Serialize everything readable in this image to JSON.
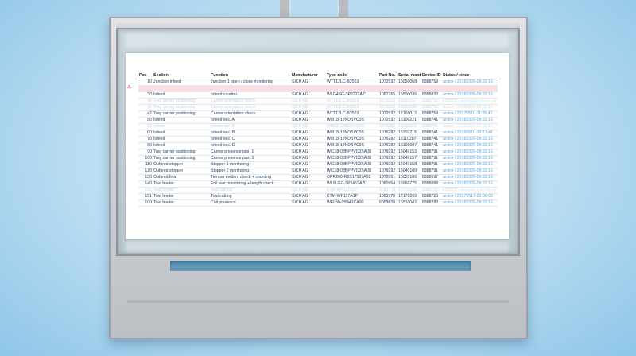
{
  "table": {
    "columns": [
      "Pos",
      "Section",
      "Function",
      "Manufacturer",
      "Type code",
      "Part No.",
      "Serial number",
      "Device-ID",
      "Status / since"
    ],
    "rows": [
      {
        "pos": "10",
        "section": "Junction infeed",
        "function": "Junction 1 open / close monitoring",
        "manufacturer": "SICK AG",
        "type_code": "WTT12LC-B2563",
        "part_no": "1072532",
        "serial": "16050058",
        "device_id": "8388759",
        "status": "active / 20160326-09:32:16",
        "style": "normal"
      },
      {
        "pos": "",
        "section": "",
        "function": "",
        "manufacturer": "",
        "type_code": "",
        "part_no": "",
        "serial": "",
        "device_id": "",
        "status": "",
        "style": "highlight"
      },
      {
        "pos": "30",
        "section": "Infeed",
        "function": "Infeed counter",
        "manufacturer": "SICK AG",
        "type_code": "WLG4SC-3P2232A71",
        "part_no": "1067765",
        "serial": "15500036",
        "device_id": "8388832",
        "status": "active / 20160326-09:32:16",
        "style": "normal"
      },
      {
        "pos": "40",
        "section": "Tray carrier positioning",
        "function": "Carrier orientation check",
        "manufacturer": "SICK AG",
        "type_code": "WTT12LC-B2563",
        "part_no": "1072532",
        "serial": "16050157",
        "device_id": "8388758",
        "status": "inactive / 20160326-09:32:16",
        "style": "faded"
      },
      {
        "pos": "41",
        "section": "Tray carrier positioning",
        "function": "Carrier orientation check",
        "manufacturer": "SICK AG",
        "type_code": "WTT12LC-B2563",
        "part_no": "1072532",
        "serial": "16050033",
        "device_id": "8388759",
        "status": "active / 20160326-09:32:16",
        "style": "faded"
      },
      {
        "pos": "42",
        "section": "Tray carrier positioning",
        "function": "Carrier orientation check",
        "manufacturer": "SICK AG",
        "type_code": "WTT12LC-B2563",
        "part_no": "1072532",
        "serial": "17160012",
        "device_id": "8388759",
        "status": "active / 20170510-11:05:42",
        "style": "normal"
      },
      {
        "pos": "50",
        "section": "Infeed",
        "function": "Infeed sec. A",
        "manufacturer": "SICK AG",
        "type_code": "IMB18-12NDSVC0S",
        "part_no": "1072532",
        "serial": "16100221",
        "device_id": "8388741",
        "status": "active / 20160326-09:32:16",
        "style": "normal"
      },
      {
        "pos": "51",
        "section": "Infeed",
        "function": "Infeed sec. A",
        "manufacturer": "SICK AG",
        "type_code": "IMB18-12NDSVC0S",
        "part_no": "1076282",
        "serial": "16100222",
        "device_id": "8388741",
        "status": "active / 20160326-09:32:16",
        "style": "faded"
      },
      {
        "pos": "60",
        "section": "Infeed",
        "function": "Infeed sec. B",
        "manufacturer": "SICK AG",
        "type_code": "IMB18-12NDSVC0S",
        "part_no": "1076282",
        "serial": "16307215",
        "device_id": "8388741",
        "status": "active / 20160610-13:13:47",
        "style": "normal"
      },
      {
        "pos": "70",
        "section": "Infeed",
        "function": "Infeed sec. C",
        "manufacturer": "SICK AG",
        "type_code": "IMB18-12NDSVC0S",
        "part_no": "1076282",
        "serial": "16110287",
        "device_id": "8388741",
        "status": "active / 20160326-09:32:16",
        "style": "normal"
      },
      {
        "pos": "80",
        "section": "Infeed",
        "function": "Infeed sec. D",
        "manufacturer": "SICK AG",
        "type_code": "IMB18-12NDSVC0S",
        "part_no": "1076282",
        "serial": "16100087",
        "device_id": "8388741",
        "status": "active / 20160326-09:32:16",
        "style": "normal"
      },
      {
        "pos": "90",
        "section": "Tray carrier positioning",
        "function": "Carrier presence pos. 1",
        "manufacturer": "SICK AG",
        "type_code": "IMC18-08BPPVC0SA00",
        "part_no": "1079292",
        "serial": "16040153",
        "device_id": "8388791",
        "status": "active / 20160326-09:32:16",
        "style": "normal"
      },
      {
        "pos": "100",
        "section": "Tray carrier positioning",
        "function": "Carrier presence pos. 2",
        "manufacturer": "SICK AG",
        "type_code": "IMC18-08BPPVC0SA00",
        "part_no": "1079292",
        "serial": "16040157",
        "device_id": "8388791",
        "status": "active / 20160326-09:32:16",
        "style": "normal"
      },
      {
        "pos": "110",
        "section": "Outfeed stopper",
        "function": "Stopper 1 monitoring",
        "manufacturer": "SICK AG",
        "type_code": "IMC18-08BPPVC0SA00",
        "part_no": "1079292",
        "serial": "16040158",
        "device_id": "8388791",
        "status": "active / 20160326-09:32:16",
        "style": "normal"
      },
      {
        "pos": "120",
        "section": "Outfeed stopper",
        "function": "Stopper 2 monitoring",
        "manufacturer": "SICK AG",
        "type_code": "IMC18-08BPPVC0SA00",
        "part_no": "1079292",
        "serial": "16040180",
        "device_id": "8388791",
        "status": "active / 20160326-09:32:16",
        "style": "normal"
      },
      {
        "pos": "130",
        "section": "Outfeed final",
        "function": "Temper evident check + counting",
        "manufacturer": "SICK AG",
        "type_code": "OPR200-R8S17537A01",
        "part_no": "1072051",
        "serial": "16020186",
        "device_id": "8388697",
        "status": "active / 20160326-09:32:16",
        "style": "normal"
      },
      {
        "pos": "140",
        "section": "Tout feeder",
        "function": "Foil tear monitoring + length check",
        "manufacturer": "SICK AG",
        "type_code": "WL9LGC-3P2452A70",
        "part_no": "1080954",
        "serial": "16060775",
        "device_id": "8388888",
        "status": "active / 20160326-09:32:16",
        "style": "normal"
      },
      {
        "pos": "150",
        "section": "Tout feeder",
        "function": "Tout cutting",
        "manufacturer": "SICK AG",
        "type_code": "KTM-WP11781P",
        "part_no": "1061770",
        "serial": "17170269",
        "device_id": "8388720",
        "status": "inactive / 20170517-21:06:03",
        "style": "faded"
      },
      {
        "pos": "151",
        "section": "Tout feeder",
        "function": "Tout cutting",
        "manufacturer": "SICK AG",
        "type_code": "KTM-WP117A1P",
        "part_no": "1061770",
        "serial": "17170269",
        "device_id": "8388720",
        "status": "active / 20170517-21:06:03",
        "style": "normal"
      },
      {
        "pos": "160",
        "section": "Tout feeder",
        "function": "Coil presence",
        "manufacturer": "SICK AG",
        "type_code": "WFL30-95B41CA00",
        "part_no": "6058638",
        "serial": "15510042",
        "device_id": "8388782",
        "status": "active / 20160326-09:32:16",
        "style": "normal"
      }
    ]
  },
  "colors": {
    "status_active": "#5aa3d8",
    "highlight_row": "#f8dde3",
    "slot": "#4b83a9"
  }
}
